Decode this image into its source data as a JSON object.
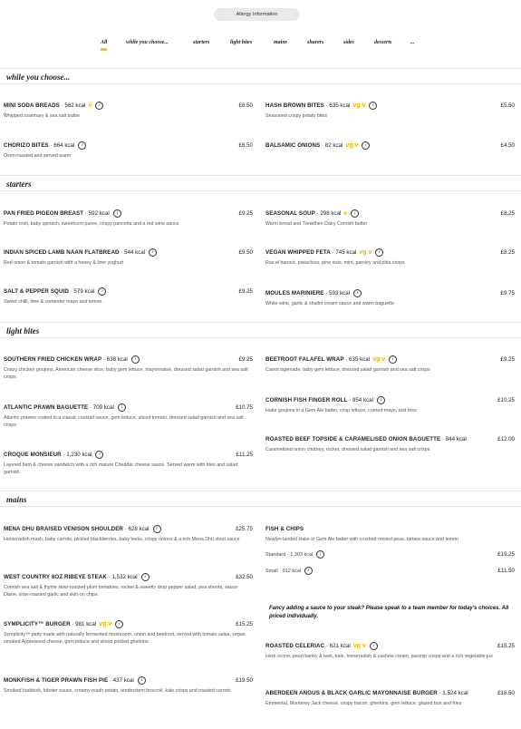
{
  "header": {
    "allergy_button": "Allergy Information"
  },
  "tabs": [
    "All",
    "while you choose...",
    "starters",
    "light bites",
    "mains",
    "sharers",
    "sides",
    "desserts",
    "..."
  ],
  "sections": {
    "while_you_choose": "while you choose...",
    "starters": "starters",
    "light_bites": "light bites",
    "mains": "mains"
  },
  "items": {
    "soda": {
      "name": "MINI SODA BREADS",
      "kcal": "· 562 kcal",
      "badge": "v",
      "price": "£6.50",
      "desc": "Whipped rosemary & sea salt butter"
    },
    "hashbrown": {
      "name": "HASH BROWN BITES",
      "kcal": "· 635 kcal",
      "badge": "vg v",
      "price": "£5.50",
      "desc": "Seasoned crispy potato bites"
    },
    "chorizo": {
      "name": "CHORIZO BITES",
      "kcal": "· 664 kcal",
      "badge": "",
      "price": "£6.50",
      "desc": "Oven-roasted and served warm"
    },
    "onions": {
      "name": "BALSAMIC ONIONS",
      "kcal": "· 82 kcal",
      "badge": "vg v",
      "price": "£4.50",
      "desc": ""
    },
    "pigeon": {
      "name": "PAN FRIED PIGEON BREAST",
      "kcal": "· 592 kcal",
      "badge": "",
      "price": "£9.25",
      "desc": "Potato rosti, baby spinach, sweetcorn puree, crispy pancetta and a red wine sauce"
    },
    "soup": {
      "name": "SEASONAL SOUP",
      "kcal": "· 298 kcal",
      "badge": "v",
      "price": "£8.25",
      "desc": "Warm bread and Trewithen Dairy Cornish butter"
    },
    "lamb": {
      "name": "INDIAN SPICED LAMB NAAN FLATBREAD",
      "kcal": "· 544 kcal",
      "badge": "",
      "price": "£9.50",
      "desc": "Red onion & tomato garnish with a honey & lime yoghurt"
    },
    "feta": {
      "name": "VEGAN WHIPPED FETA",
      "kcal": "· 745 kcal",
      "badge": "vg v",
      "price": "£8.25",
      "desc": "Ras el hanout, pistachios, pine nuts, mint, parsley and pitta crisps"
    },
    "squid": {
      "name": "SALT & PEPPER SQUID",
      "kcal": "· 579 kcal",
      "badge": "",
      "price": "£9.25",
      "desc": "Sweet chilli, lime & coriander mayo and lemon."
    },
    "moules": {
      "name": "MOULES MARINIERE",
      "kcal": "· 593 kcal",
      "badge": "",
      "price": "£9.75",
      "desc": "White wine, garlic & shallot cream sauce and warm baguette"
    },
    "chicken_wrap": {
      "name": "SOUTHERN FRIED CHICKEN WRAP",
      "kcal": "· 638 kcal",
      "badge": "",
      "price": "£9.25",
      "desc": "Crispy chicken goujons, American cheese slice, baby gem lettuce, mayonnaise, dressed salad garnish and sea salt crisps"
    },
    "falafel": {
      "name": "BEETROOT FALAFEL WRAP",
      "kcal": "· 635 kcal",
      "badge": "vg v",
      "price": "£9.25",
      "desc": "Carrot tapenade, baby gem lettuce, dressed salad garnish and sea salt crisps"
    },
    "prawn": {
      "name": "ATLANTIC PRAWN BAGUETTE",
      "kcal": "· 709 kcal",
      "badge": "",
      "price": "£10.75",
      "desc": "Atlantic prawns coated in a classic cocktail sauce, gem lettuce, sliced tomato, dressed salad garnish and sea salt crisps"
    },
    "finger_roll": {
      "name": "CORNISH FISH FINGER ROLL",
      "kcal": "· 954 kcal",
      "badge": "",
      "price": "£10.25",
      "desc": "Hake goujons in a Gem Ale batter, crisp lettuce, curried mayo, and fries"
    },
    "croque": {
      "name": "CROQUE MONSIEUR",
      "kcal": "· 1,230 kcal",
      "badge": "",
      "price": "£11.25",
      "desc": "Layered ham & cheese sandwich with a rich mature Cheddar cheese sauce. Served warm with fries and salad garnish."
    },
    "beef_baguette": {
      "name": "ROASTED BEEF TOPSIDE & CARAMELISED ONION BAGUETTE",
      "kcal": "· 844 kcal",
      "badge": "",
      "price": "£12.00",
      "desc": "Caramelised onion chutney, rocket, dressed salad garnish and sea salt crisps"
    },
    "venison": {
      "name": "MENA DHU BRAISED VENISON SHOULDER",
      "kcal": "· 628 kcal",
      "badge": "",
      "price": "£25.75",
      "desc": "Horseradish mash, baby carrots, pickled blackberries, baby leeks, crispy onions & a rich Mena Dhu stout sauce"
    },
    "fish_chips": {
      "name": "FISH & CHIPS",
      "kcal": "",
      "badge": "",
      "price": "",
      "desc": "Newlyn-landed Hake in Gem Ale batter with crushed minted peas, tartare sauce and lemon",
      "variants": [
        {
          "label": "Standard · 1,303 kcal",
          "price": "£19.25"
        },
        {
          "label": "Small · 912 kcal",
          "price": "£11.50"
        }
      ]
    },
    "ribeye": {
      "name": "WEST COUNTRY 8OZ RIBEYE STEAK",
      "kcal": "· 1,532 kcal",
      "badge": "",
      "price": "£32.50",
      "desc": "Cornish sea salt & thyme slow-roasted plum tomatoes, rocket & sweetly drop pepper salad, pea shoots, sauce Diane, slow-roasted garlic and skin-on chips"
    },
    "symplicity": {
      "name": "SYMPLICITY™ BURGER",
      "kcal": "· 981 kcal",
      "badge": "vg v",
      "price": "£15.25",
      "desc": "Symplicity™ patty made with naturally fermented mushroom, onion and beetroot, served with tomato salsa, vegan smoked Applewood cheese, gem lettuce and sliced pickled gherkins"
    },
    "celeriac": {
      "name": "ROASTED CELERIAC",
      "kcal": "· 621 kcal",
      "badge": "vg v",
      "price": "£15.25",
      "desc": "Herb scone, pearl barley & leek, kale, horseradish & cashew cream, parsnip crisps and a rich vegetable jus"
    },
    "monkfish": {
      "name": "MONKFISH & TIGER PRAWN FISH PIE",
      "kcal": "· 437 kcal",
      "badge": "",
      "price": "£19.50",
      "desc": "Smoked haddock, lobster sauce, creamy mash potato, tenderstem broccoli, kale crisps and roasted carrots"
    },
    "aberdeen": {
      "name": "ABERDEEN ANGUS & BLACK GARLIC MAYONNAISE BURGER",
      "kcal": "· 1,524 kcal",
      "badge": "",
      "price": "£18.50",
      "desc": "Emmental, Monterey Jack cheese, crispy bacon, gherkins, gem lettuce, glazed bun and fries"
    }
  },
  "steak_note": "Fancy adding a sauce to your steak? Please speak to a team member for today's choices. All priced individually.",
  "colors": {
    "accent": "#f0c419",
    "badge": "#e6b800"
  }
}
